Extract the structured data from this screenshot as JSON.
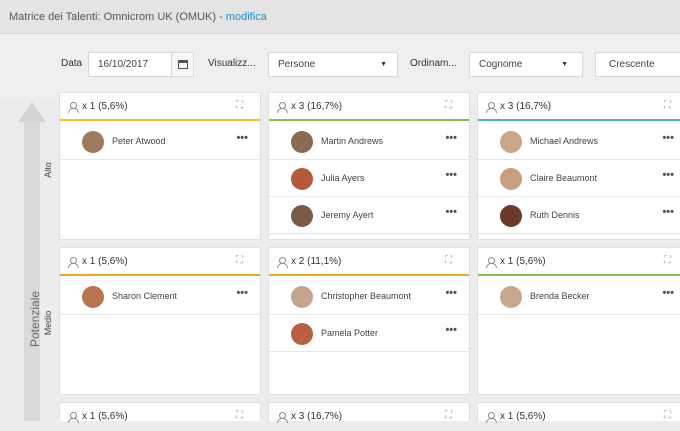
{
  "header": {
    "title": "Matrice dei Talenti: Omnicrom UK (OMUK) - ",
    "link": "modifica"
  },
  "filters": {
    "date_label": "Data",
    "date_value": "16/10/2017",
    "view_label": "Visualizz...",
    "view_value": "Persone",
    "sort_label": "Ordinam...",
    "sort_value": "Cognome",
    "order_value": "Crescente"
  },
  "axis": {
    "title": "Potenziale",
    "levels": [
      "Alto",
      "Medio"
    ]
  },
  "colors": {
    "orange": "#f0a31c",
    "green": "#7ec24b",
    "teal": "#4fb3a9",
    "yellow": "#f2c318"
  },
  "cells": [
    {
      "count": "x 1 (5,6%)",
      "people": [
        {
          "name": "Peter Atwood",
          "avatar": "#a07a5e"
        }
      ]
    },
    {
      "count": "x 3 (16,7%)",
      "people": [
        {
          "name": "Martin Andrews",
          "avatar": "#8a6a52"
        },
        {
          "name": "Julia Ayers",
          "avatar": "#b35a3c"
        },
        {
          "name": "Jeremy Ayert",
          "avatar": "#7d5a45"
        }
      ]
    },
    {
      "count": "x 3 (16,7%)",
      "people": [
        {
          "name": "Michael Andrews",
          "avatar": "#c9a58a"
        },
        {
          "name": "Claire Beaumont",
          "avatar": "#c89f7e"
        },
        {
          "name": "Ruth Dennis",
          "avatar": "#6a3a2a"
        }
      ]
    },
    {
      "count": "x 1 (5,6%)",
      "people": [
        {
          "name": "Sharon Clement",
          "avatar": "#b87350"
        }
      ]
    },
    {
      "count": "x 2 (11,1%)",
      "people": [
        {
          "name": "Christopher Beaumont",
          "avatar": "#c7a48c"
        },
        {
          "name": "Pamela Potter",
          "avatar": "#b85f3e"
        }
      ]
    },
    {
      "count": "x 1 (5,6%)",
      "people": [
        {
          "name": "Brenda Becker",
          "avatar": "#c8a58d"
        }
      ]
    },
    {
      "count": "x 1 (5,6%)",
      "people": []
    },
    {
      "count": "x 3 (16,7%)",
      "people": []
    },
    {
      "count": "x 1 (5,6%)",
      "people": []
    }
  ],
  "more_label": "•••",
  "expand_label": "⛶"
}
